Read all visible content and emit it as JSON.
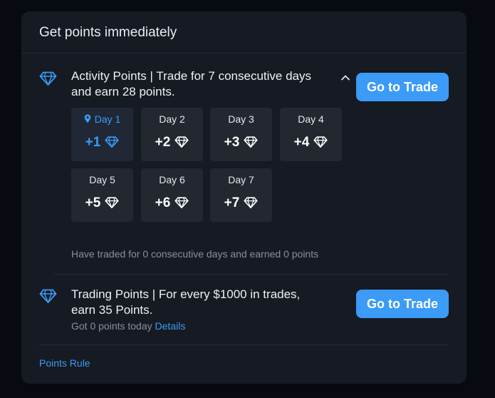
{
  "header": {
    "title": "Get points immediately"
  },
  "activity": {
    "icon": "diamond-icon",
    "title": "Activity Points | Trade for 7 consecutive days and earn 28 points.",
    "button_label": "Go to Trade",
    "expanded": true,
    "current_day": 1,
    "days": [
      {
        "label": "Day 1",
        "points": "+1",
        "active": true
      },
      {
        "label": "Day 2",
        "points": "+2",
        "active": false
      },
      {
        "label": "Day 3",
        "points": "+3",
        "active": false
      },
      {
        "label": "Day 4",
        "points": "+4",
        "active": false
      },
      {
        "label": "Day 5",
        "points": "+5",
        "active": false
      },
      {
        "label": "Day 6",
        "points": "+6",
        "active": false
      },
      {
        "label": "Day 7",
        "points": "+7",
        "active": false
      }
    ],
    "status": "Have traded for 0 consecutive days and earned 0 points"
  },
  "trading": {
    "icon": "diamond-icon",
    "title": "Trading Points | For every $1000 in trades, earn 35 Points.",
    "button_label": "Go to Trade",
    "subtext": "Got 0 points today",
    "details_link": "Details"
  },
  "footer": {
    "rule_link": "Points Rule"
  },
  "colors": {
    "accent": "#3b9bf7",
    "card_bg": "#161a22",
    "tile_bg": "#232730",
    "page_bg": "#070a11"
  }
}
